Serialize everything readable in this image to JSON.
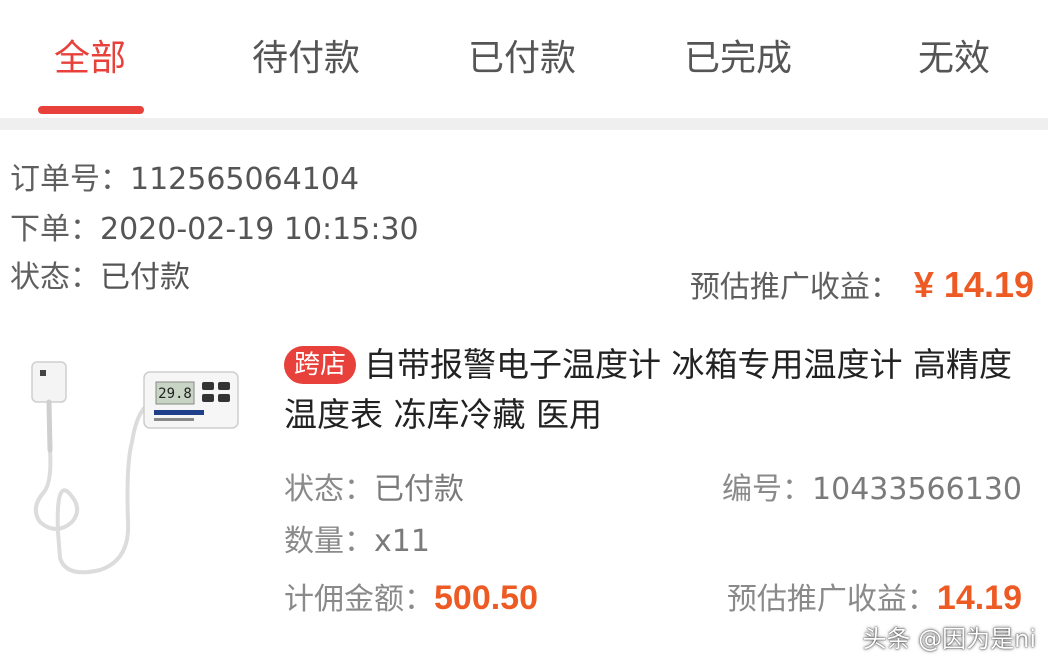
{
  "tabs": [
    {
      "label": "全部",
      "active": true
    },
    {
      "label": "待付款"
    },
    {
      "label": "已付款"
    },
    {
      "label": "已完成"
    },
    {
      "label": "无效"
    }
  ],
  "order": {
    "number_label": "订单号：",
    "number": "112565064104",
    "time_label": "下单：",
    "time": "2020-02-19 10:15:30",
    "status_label": "状态：",
    "status": "已付款",
    "earning_label": "预估推广收益：",
    "earning": "¥ 14.19"
  },
  "item": {
    "badge": "跨店",
    "title": "自带报警电子温度计 冰箱专用温度计 高精度温度表 冻库冷藏 医用",
    "status_label": "状态：",
    "status": "已付款",
    "code_label": "编号：",
    "code": "10433566130",
    "qty_label": "数量：",
    "qty": "x11",
    "amount_label": "计佣金额：",
    "amount": "500.50",
    "earning_label": "预估推广收益：",
    "earning": "14.19",
    "display_reading": "29.8"
  },
  "watermark": "头条 @因为是ni",
  "colors": {
    "accent": "#e8403a",
    "amount": "#ee5a24"
  }
}
